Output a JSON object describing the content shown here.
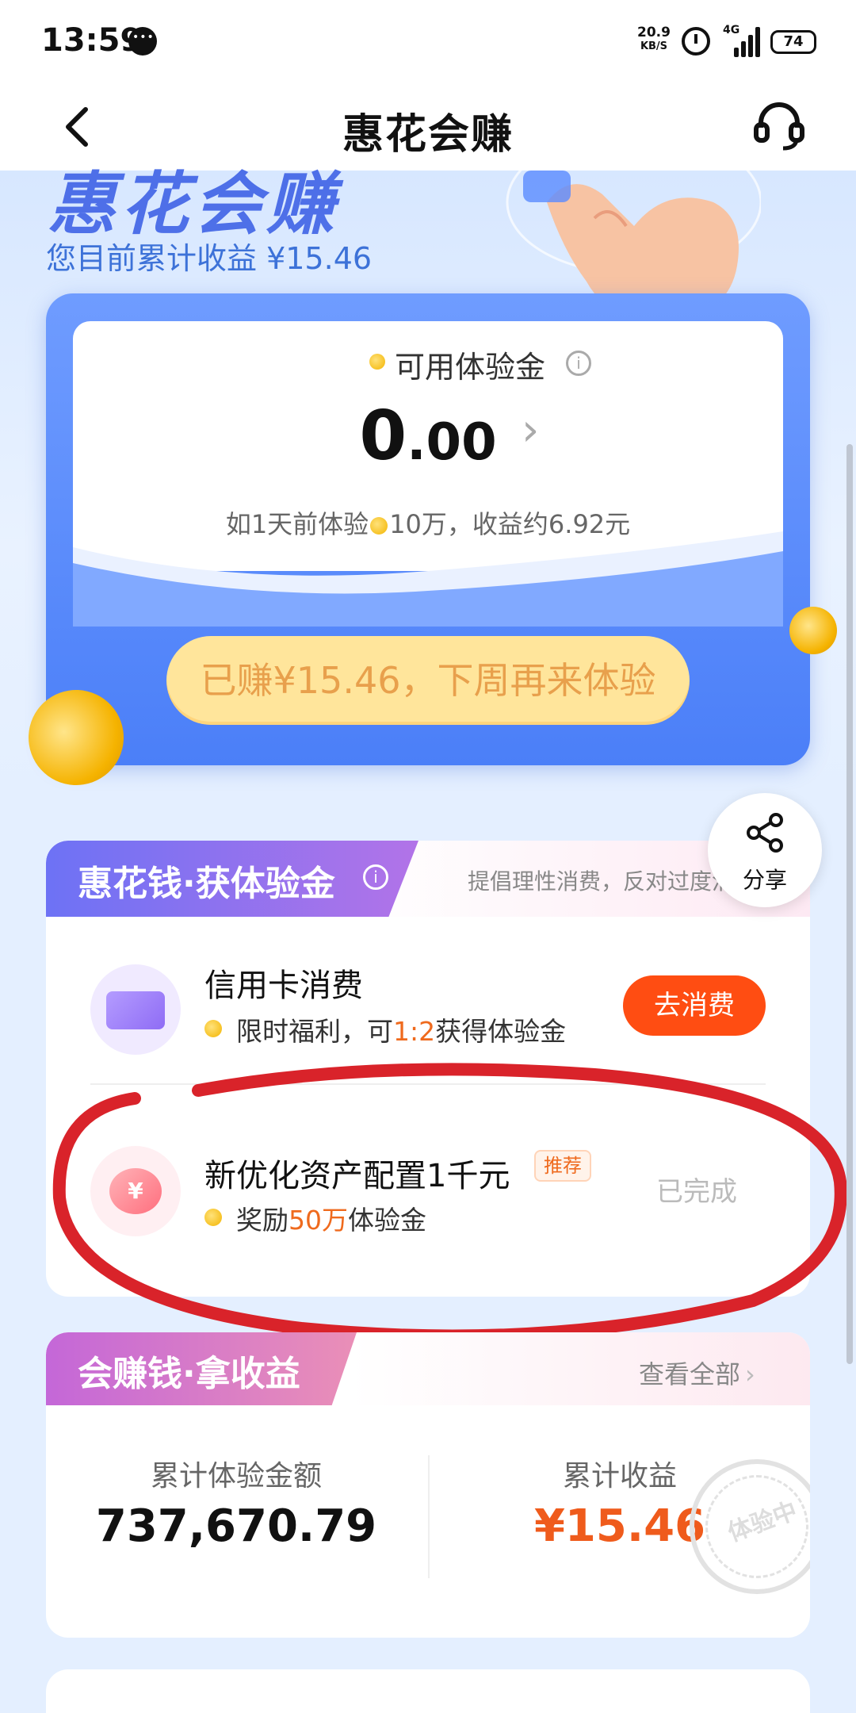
{
  "status_bar": {
    "time": "13:59",
    "net_speed_value": "20.9",
    "net_speed_unit": "KB/S",
    "network": "4G",
    "battery": "74"
  },
  "nav": {
    "title": "惠花会赚"
  },
  "hero": {
    "brand_text": "惠花会赚",
    "earnings_text": "您目前累计收益 ¥15.46",
    "card_label": "可用体验金",
    "card_amount_int": "0",
    "card_amount_dec": ".00",
    "card_sub": "如1天前体验",
    "card_sub_tail": "10万，收益约6.92元",
    "cta_label": "已赚¥15.46，下周再来体验"
  },
  "share": {
    "label": "分享"
  },
  "section1": {
    "title": "惠花钱·获体验金",
    "slogan": "提倡理性消费，反对过度消费",
    "rows": [
      {
        "title": "信用卡消费",
        "desc_pre": "限时福利，可",
        "desc_hl": "1:2",
        "desc_post": "获得体验金",
        "button": "去消费"
      },
      {
        "title": "新优化资产配置1千元",
        "badge": "推荐",
        "desc_pre": "奖励",
        "desc_hl": "50万",
        "desc_post": "体验金",
        "status": "已完成",
        "icon_symbol": "¥"
      }
    ]
  },
  "section2": {
    "title": "会赚钱·拿收益",
    "view_all": "查看全部",
    "stat1_label": "累计体验金额",
    "stat1_value": "737,670.79",
    "stat2_label": "累计收益",
    "stat2_value": "¥15.46",
    "stamp_text": "体验中"
  },
  "colors": {
    "accent_blue": "#4b7ff8",
    "cta_yellow": "#ffe59b",
    "action_orange": "#ff4d12",
    "highlight_orange": "#ef6a1d",
    "annotation_red": "#d9232a"
  },
  "icons": {
    "back": "back-arrow-icon",
    "service": "headset-icon",
    "share": "share-icon",
    "info": "info-icon",
    "coin": "coin-icon"
  }
}
